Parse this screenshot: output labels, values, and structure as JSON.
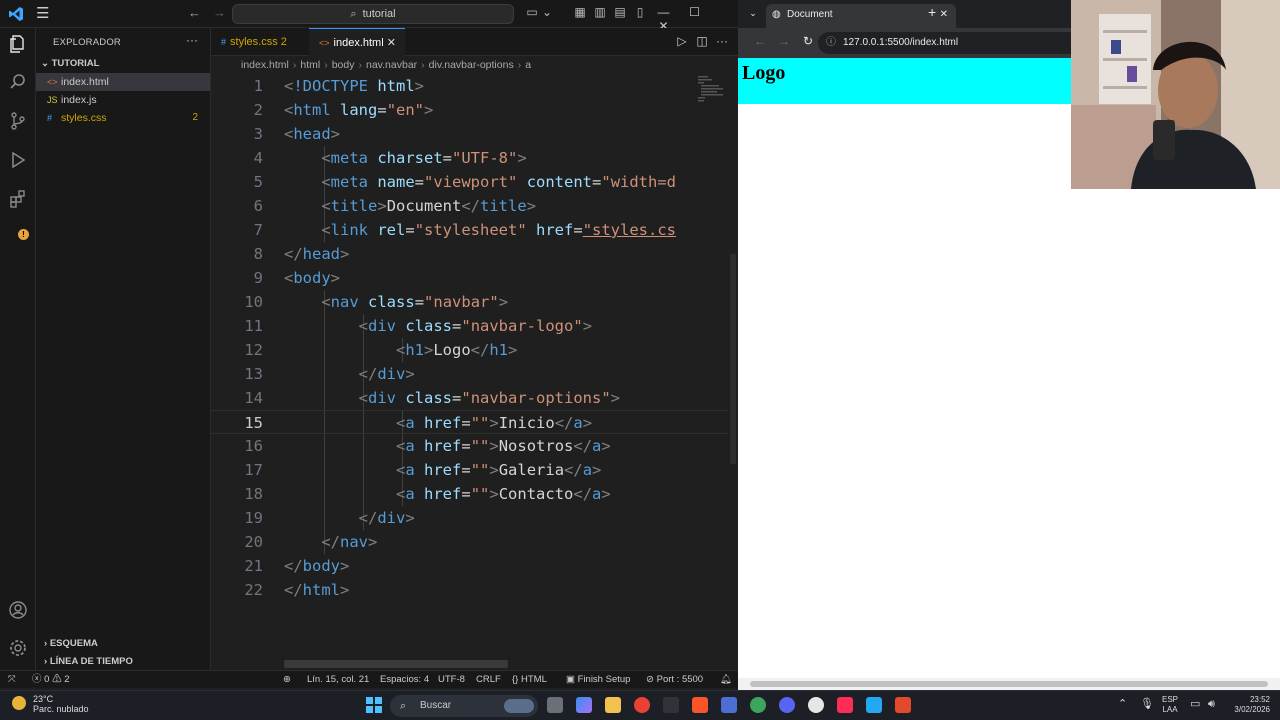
{
  "vscode": {
    "search_text": "tutorial",
    "sidebar": {
      "title": "EXPLORADOR",
      "folder": "TUTORIAL",
      "files": [
        {
          "name": "index.html",
          "badge": ""
        },
        {
          "name": "index.js",
          "badge": ""
        },
        {
          "name": "styles.css",
          "badge": "2"
        }
      ],
      "outline": "ESQUEMA",
      "timeline": "LÍNEA DE TIEMPO"
    },
    "tabs": [
      {
        "label": "styles.css",
        "badge": "2"
      },
      {
        "label": "index.html",
        "close": "✕"
      }
    ],
    "breadcrumb": [
      "index.html",
      "html",
      "body",
      "nav.navbar",
      "div.navbar-options",
      "a"
    ],
    "line_numbers": [
      "1",
      "2",
      "3",
      "4",
      "5",
      "6",
      "7",
      "8",
      "9",
      "10",
      "11",
      "12",
      "13",
      "14",
      "15",
      "16",
      "17",
      "18",
      "19",
      "20",
      "21",
      "22"
    ],
    "code": {
      "l1_doctype": "!DOCTYPE",
      "l1_html": "html",
      "html": "html",
      "lang": "lang",
      "en": "\"en\"",
      "head": "head",
      "meta": "meta",
      "charset": "charset",
      "utf8": "\"UTF-8\"",
      "name": "name",
      "viewport": "\"viewport\"",
      "content": "content",
      "widthd": "\"width=d",
      "title": "title",
      "document": "Document",
      "link": "link",
      "rel": "rel",
      "stylesheet": "\"stylesheet\"",
      "href": "href",
      "stylescs": "\"styles.cs",
      "body": "body",
      "nav": "nav",
      "class": "class",
      "navbar": "\"navbar\"",
      "div": "div",
      "navbarlogo": "\"navbar-logo\"",
      "h1": "h1",
      "logo": "Logo",
      "navbaroptions": "\"navbar-options\"",
      "a": "a",
      "empty": "\"\"",
      "inicio": "Inicio",
      "nosotros": "Nosotros",
      "galeria": "Galeria",
      "contacto": "Contacto"
    },
    "status": {
      "errors": "0",
      "warnings": "2",
      "position": "Lín. 15, col. 21",
      "spaces": "Espacios: 4",
      "encoding": "UTF-8",
      "eol": "CRLF",
      "language": "HTML",
      "finish_setup": "Finish Setup",
      "port": "Port : 5500"
    }
  },
  "browser": {
    "tab_title": "Document",
    "url": "127.0.0.1:5500/index.html",
    "page_logo": "Logo"
  },
  "taskbar": {
    "temperature": "23°C",
    "weather": "Parc. nublado",
    "search": "Buscar",
    "lang1": "ESP",
    "lang2": "LAA",
    "time": "23:52",
    "date": "3/02/2026"
  },
  "colors": {
    "accent": "#3794ff",
    "page_nav_bg": "#00ffff",
    "tag": "#569cd6",
    "attr": "#9cdcfe",
    "string": "#ce9178"
  }
}
